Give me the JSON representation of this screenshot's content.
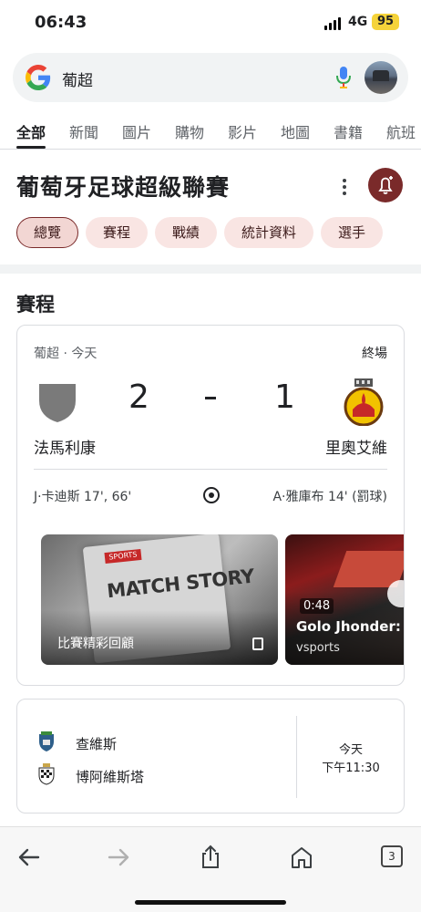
{
  "status_bar": {
    "time": "06:43",
    "network": "4G",
    "battery": "95"
  },
  "search": {
    "query": "葡超"
  },
  "tabs": [
    {
      "label": "全部",
      "active": true
    },
    {
      "label": "新聞"
    },
    {
      "label": "圖片"
    },
    {
      "label": "購物"
    },
    {
      "label": "影片"
    },
    {
      "label": "地圖"
    },
    {
      "label": "書籍"
    },
    {
      "label": "航班"
    }
  ],
  "knowledge_panel": {
    "title": "葡萄牙足球超級聯賽",
    "chips": [
      {
        "label": "總覽",
        "active": true
      },
      {
        "label": "賽程"
      },
      {
        "label": "戰績"
      },
      {
        "label": "統計資料"
      },
      {
        "label": "選手"
      }
    ]
  },
  "schedule": {
    "section_title": "賽程",
    "match": {
      "meta": "葡超 · 今天",
      "status": "終場",
      "home": {
        "name": "法馬利康",
        "score": "2",
        "scorers": "J·卡迪斯 17', 66'"
      },
      "away": {
        "name": "里奧艾維",
        "score": "1",
        "scorers": "A·雅庫布 14' (罰球)"
      }
    },
    "videos": [
      {
        "overlay_brand": "SPORTS",
        "overlay_title": "MATCH STORY",
        "label": "比賽精彩回顧"
      },
      {
        "duration": "0:48",
        "title": "Golo Jhonder: F",
        "source": "vsports"
      }
    ],
    "upcoming": {
      "teams": [
        "查維斯",
        "博阿維斯塔"
      ],
      "day": "今天",
      "time": "下午11:30"
    }
  },
  "bottom_bar": {
    "tab_count": "3"
  },
  "colors": {
    "accent": "#7a2a2a",
    "chip_bg": "#f9e5e3",
    "divider": "#dadce0"
  }
}
